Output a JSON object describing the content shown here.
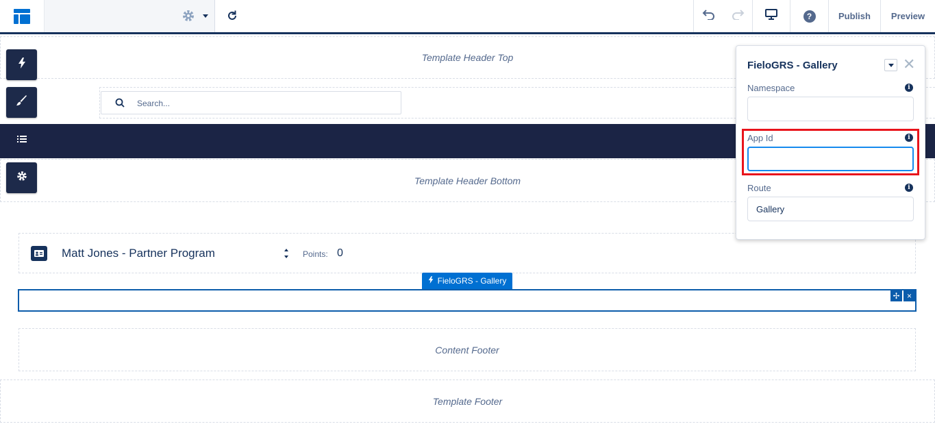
{
  "toolbar": {
    "publish_label": "Publish",
    "preview_label": "Preview",
    "help_label": "?"
  },
  "regions": {
    "header_top": "Template Header Top",
    "header_bottom": "Template Header Bottom",
    "content_footer": "Content Footer",
    "template_footer": "Template Footer"
  },
  "search": {
    "placeholder": "Search..."
  },
  "member": {
    "name": "Matt Jones - Partner Program",
    "points_label": "Points:",
    "points_value": "0"
  },
  "component": {
    "tab_label": "FieloGRS - Gallery",
    "move_label": "✢",
    "close_label": "×"
  },
  "panel": {
    "title": "FieloGRS - Gallery",
    "close_label": "✕",
    "fields": [
      {
        "label": "Namespace",
        "value": ""
      },
      {
        "label": "App Id",
        "value": ""
      },
      {
        "label": "Route",
        "value": "Gallery"
      }
    ]
  },
  "colors": {
    "brand_blue": "#0070d2",
    "navy": "#16325c",
    "highlight": "#e8141c"
  }
}
